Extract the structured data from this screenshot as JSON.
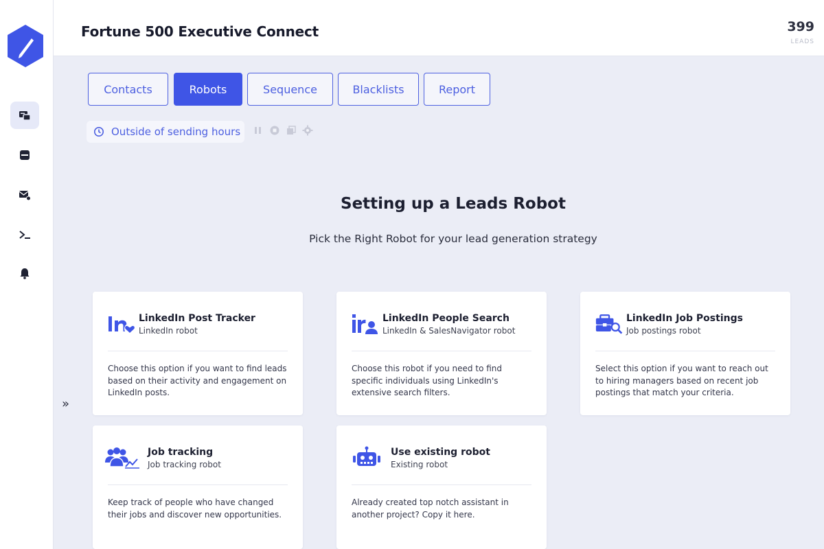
{
  "header": {
    "title": "Fortune 500 Executive Connect",
    "lead_count": "399",
    "lead_label": "LEADS"
  },
  "tabs": [
    {
      "label": "Contacts"
    },
    {
      "label": "Robots"
    },
    {
      "label": "Sequence"
    },
    {
      "label": "Blacklists"
    },
    {
      "label": "Report"
    }
  ],
  "status": {
    "text": "Outside of sending hours"
  },
  "section": {
    "title": "Setting up a Leads Robot",
    "subtitle": "Pick the Right Robot for your lead generation strategy"
  },
  "expand_label": "»",
  "cards": [
    {
      "title": "LinkedIn Post Tracker",
      "subtitle": "LinkedIn robot",
      "description": "Choose this option if you want to find leads based on their activity and engagement on LinkedIn posts.",
      "icon": "linkedin-heart-icon"
    },
    {
      "title": "LinkedIn People Search",
      "subtitle": "LinkedIn & SalesNavigator robot",
      "description": "Choose this robot if you need to find specific individuals using LinkedIn's extensive search filters.",
      "icon": "linkedin-person-icon"
    },
    {
      "title": "LinkedIn Job Postings",
      "subtitle": "Job postings robot",
      "description": "Select this option if you want to reach out to hiring managers based on recent job postings that match your criteria.",
      "icon": "briefcase-search-icon"
    },
    {
      "title": "Job tracking",
      "subtitle": "Job tracking robot",
      "description": "Keep track of people who have changed their jobs and discover new opportunities.",
      "icon": "people-chart-icon"
    },
    {
      "title": "Use existing robot",
      "subtitle": "Existing robot",
      "description": "Already created top notch assistant in another project? Copy it here.",
      "icon": "robot-icon"
    }
  ],
  "colors": {
    "accent": "#3f55e6",
    "background": "#ebedf6"
  }
}
